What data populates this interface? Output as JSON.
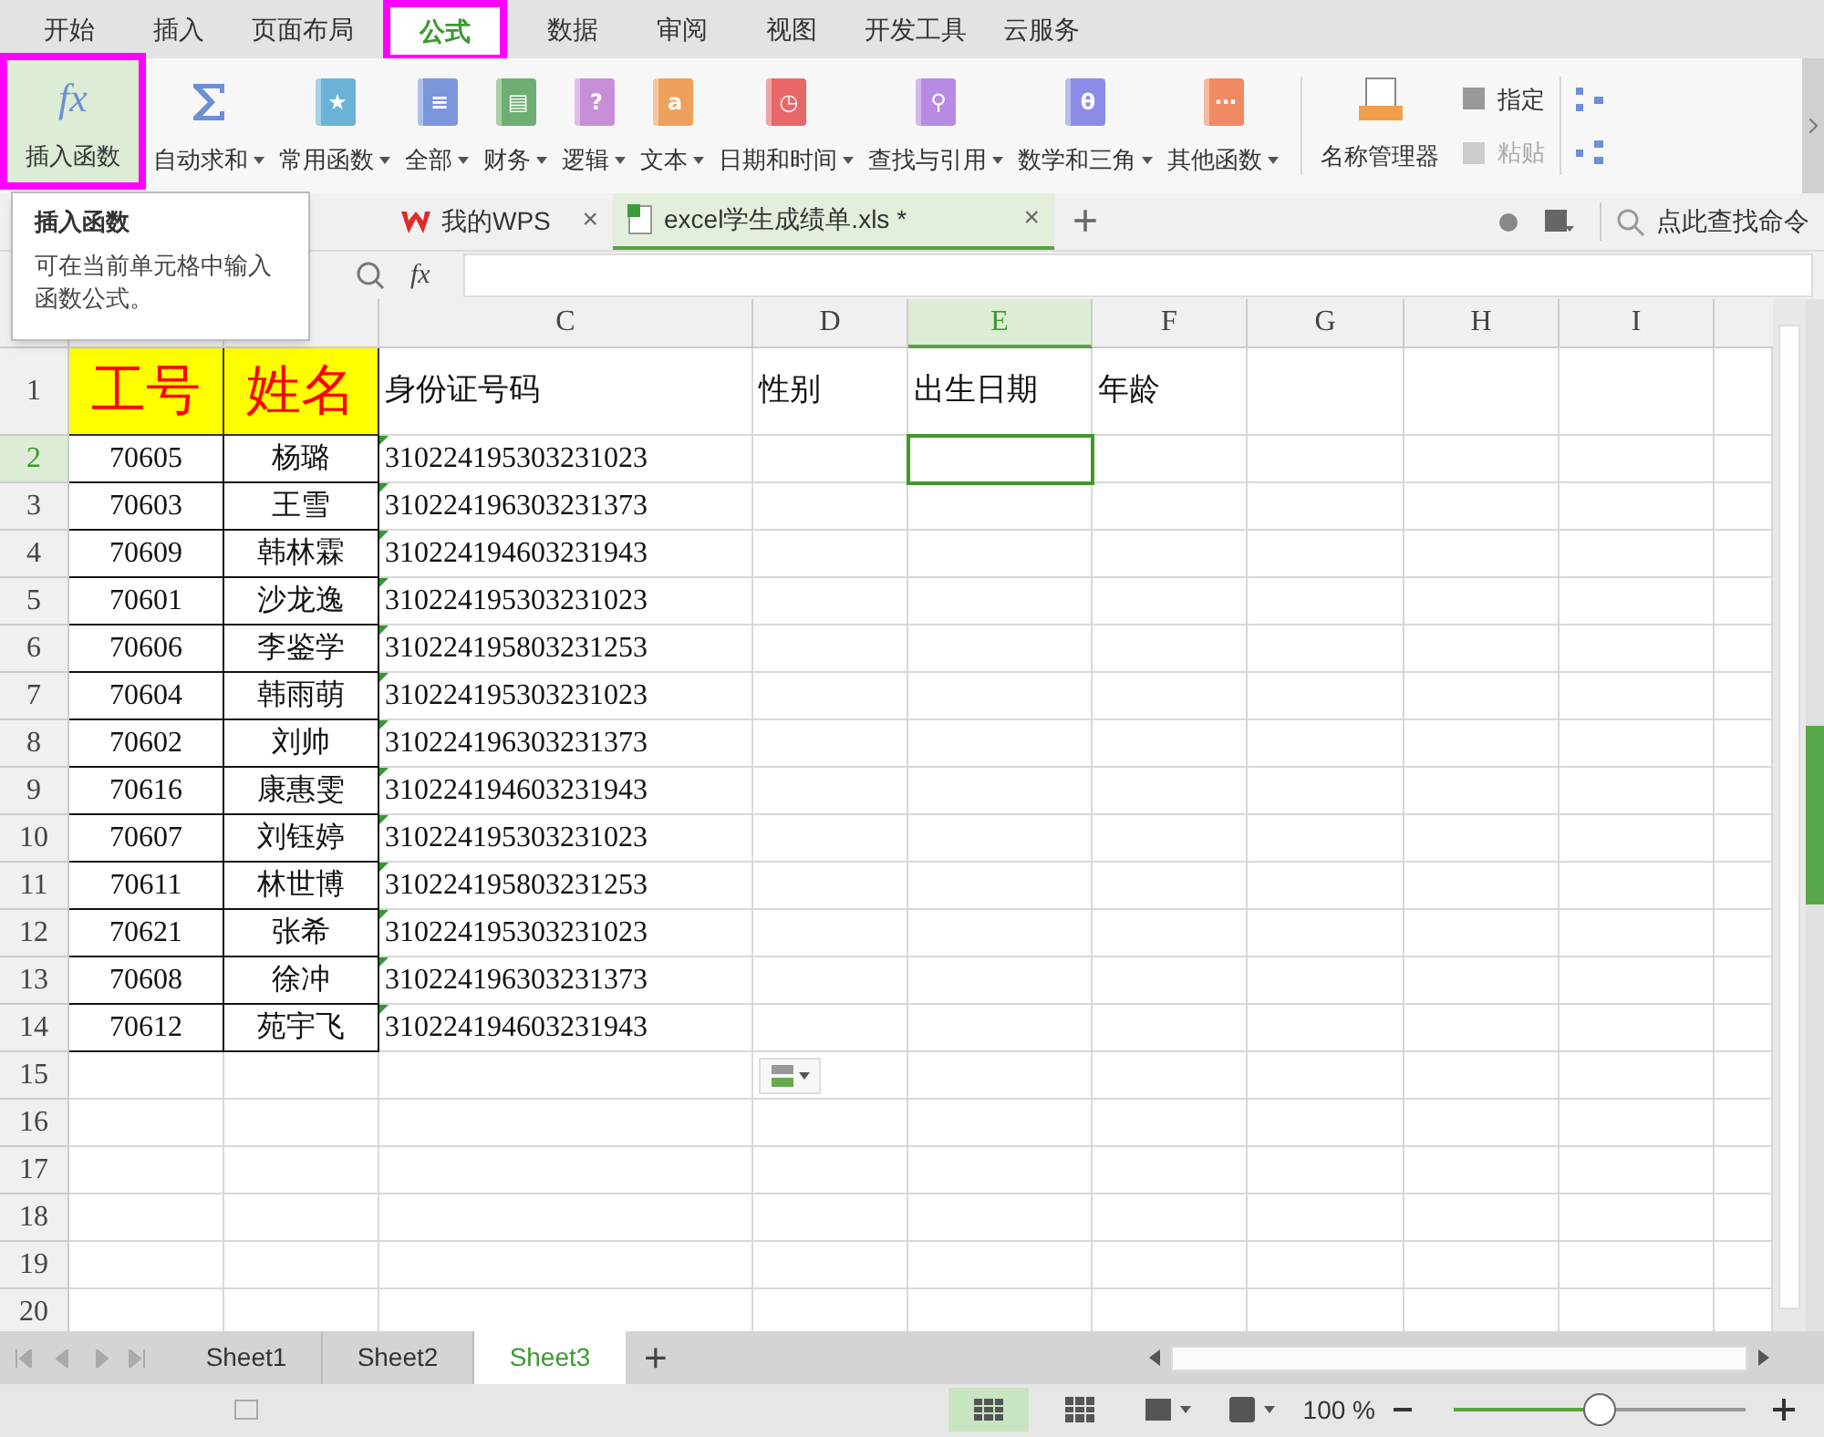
{
  "menu_tabs": [
    {
      "label": "开始",
      "selected": false
    },
    {
      "label": "插入",
      "selected": false
    },
    {
      "label": "页面布局",
      "selected": false
    },
    {
      "label": "公式",
      "selected": true
    },
    {
      "label": "数据",
      "selected": false
    },
    {
      "label": "审阅",
      "selected": false
    },
    {
      "label": "视图",
      "selected": false
    },
    {
      "label": "开发工具",
      "selected": false
    },
    {
      "label": "云服务",
      "selected": false
    }
  ],
  "ribbon": {
    "groups": [
      {
        "kind": "fx",
        "label": "插入函数",
        "selected": true,
        "dropdown": false
      },
      {
        "kind": "sigma",
        "label": "自动求和",
        "selected": false,
        "dropdown": true
      },
      {
        "kind": "book",
        "label": "常用函数",
        "color": "#6bb3d6",
        "glyph": "★",
        "selected": false,
        "dropdown": true
      },
      {
        "kind": "book",
        "label": "全部",
        "color": "#7c96dc",
        "glyph": "≡",
        "selected": false,
        "dropdown": true
      },
      {
        "kind": "book",
        "label": "财务",
        "color": "#6fae73",
        "glyph": "▤",
        "selected": false,
        "dropdown": true
      },
      {
        "kind": "book",
        "label": "逻辑",
        "color": "#c88fd6",
        "glyph": "?",
        "selected": false,
        "dropdown": true
      },
      {
        "kind": "book",
        "label": "文本",
        "color": "#efa05a",
        "glyph": "a",
        "selected": false,
        "dropdown": true
      },
      {
        "kind": "book",
        "label": "日期和时间",
        "color": "#e8686a",
        "glyph": "◷",
        "selected": false,
        "dropdown": true
      },
      {
        "kind": "book",
        "label": "查找与引用",
        "color": "#b78be3",
        "glyph": "⚲",
        "selected": false,
        "dropdown": true
      },
      {
        "kind": "book",
        "label": "数学和三角",
        "color": "#8c8ce8",
        "glyph": "θ",
        "selected": false,
        "dropdown": true
      },
      {
        "kind": "book",
        "label": "其他函数",
        "color": "#f08a62",
        "glyph": "⋯",
        "selected": false,
        "dropdown": true
      }
    ],
    "name_manager": "名称管理器",
    "specify": {
      "label": "指定",
      "disabled": false
    },
    "paste": {
      "label": "粘贴",
      "disabled": true
    }
  },
  "tooltip": {
    "title": "插入函数",
    "text": "可在当前单元格中输入函数公式。"
  },
  "doc_tabs": [
    {
      "label": "我的WPS",
      "kind": "wps",
      "selected": false,
      "close": "×"
    },
    {
      "label": "excel学生成绩单.xls *",
      "kind": "sheet",
      "selected": true,
      "close": "×"
    }
  ],
  "new_tab": "+",
  "command_search": "点此查找命令",
  "formula_fx": "fx",
  "columns": [
    {
      "label": "C",
      "selected": false
    },
    {
      "label": "D",
      "selected": false
    },
    {
      "label": "E",
      "selected": true
    },
    {
      "label": "F",
      "selected": false
    },
    {
      "label": "G",
      "selected": false
    },
    {
      "label": "H",
      "selected": false
    },
    {
      "label": "I",
      "selected": false
    }
  ],
  "header_row": [
    "工号",
    "姓名",
    "身份证号码",
    "性别",
    "出生日期",
    "年龄"
  ],
  "rows": [
    [
      "70605",
      "杨璐",
      "310224195303231023"
    ],
    [
      "70603",
      "王雪",
      "310224196303231373"
    ],
    [
      "70609",
      "韩林霖",
      "310224194603231943"
    ],
    [
      "70601",
      "沙龙逸",
      "310224195303231023"
    ],
    [
      "70606",
      "李鉴学",
      "310224195803231253"
    ],
    [
      "70604",
      "韩雨萌",
      "310224195303231023"
    ],
    [
      "70602",
      "刘帅",
      "310224196303231373"
    ],
    [
      "70616",
      "康惠雯",
      "310224194603231943"
    ],
    [
      "70607",
      "刘钰婷",
      "310224195303231023"
    ],
    [
      "70611",
      "林世博",
      "310224195803231253"
    ],
    [
      "70621",
      "张希",
      "310224195303231023"
    ],
    [
      "70608",
      "徐冲",
      "310224196303231373"
    ],
    [
      "70612",
      "苑宇飞",
      "310224194603231943"
    ]
  ],
  "row_numbers": [
    "1",
    "2",
    "3",
    "4",
    "5",
    "6",
    "7",
    "8",
    "9",
    "10",
    "11",
    "12",
    "13",
    "14",
    "15",
    "16",
    "17",
    "18",
    "19",
    "20"
  ],
  "sheet_tabs": [
    {
      "label": "Sheet1",
      "selected": false
    },
    {
      "label": "Sheet2",
      "selected": false
    },
    {
      "label": "Sheet3",
      "selected": true
    }
  ],
  "add_sheet": "+",
  "zoom": {
    "reading": "100 %",
    "level": 0.5
  }
}
